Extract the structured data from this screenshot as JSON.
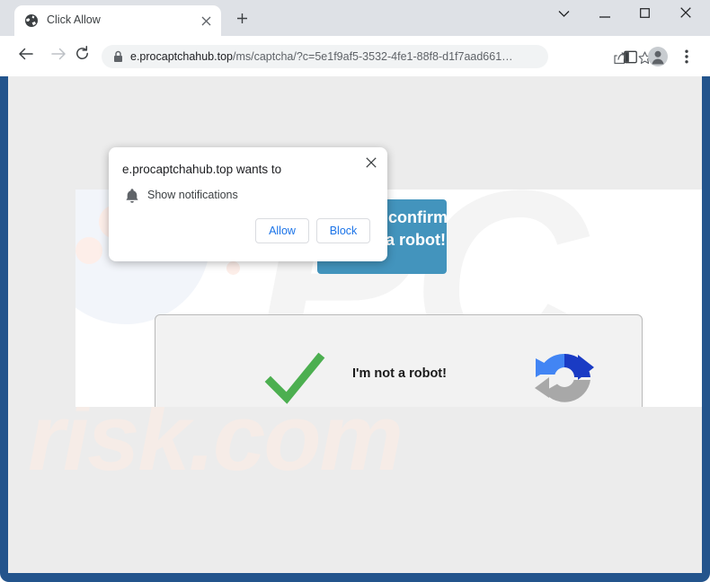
{
  "browser": {
    "tab": {
      "title": "Click Allow",
      "favicon_icon": "globe-icon",
      "close_icon": "close-icon"
    },
    "new_tab_icon": "plus-icon",
    "window_controls": {
      "tab_search_icon": "chevron-down-icon",
      "minimize_icon": "minimize-icon",
      "maximize_icon": "maximize-icon",
      "close_icon": "close-icon"
    },
    "toolbar": {
      "back_icon": "arrow-left-icon",
      "forward_icon": "arrow-right-icon",
      "reload_icon": "reload-icon",
      "lock_icon": "lock-icon",
      "url_host": "e.procaptchahub.top",
      "url_path": "/ms/captcha/?c=5e1f9af5-3532-4fe1-88f8-d1f7aad661…",
      "share_icon": "share-icon",
      "bookmark_icon": "star-icon",
      "side_panel_icon": "side-panel-icon",
      "profile_icon": "person-avatar-icon",
      "menu_icon": "three-dot-menu-icon"
    }
  },
  "permission_dialog": {
    "title": "e.procaptchahub.top wants to",
    "permission_icon": "bell-icon",
    "permission_label": "Show notifications",
    "allow_label": "Allow",
    "block_label": "Block",
    "close_icon": "close-icon"
  },
  "page": {
    "promo_banner": {
      "text": "Click «Allow» to confirm that you are not a robot!",
      "background_color": "#4394bd"
    },
    "captcha": {
      "check_icon": "green-checkmark-icon",
      "label": "I'm not a robot!",
      "refresh_icon": "refresh-arrows-icon",
      "check_color": "#4CAF50"
    },
    "watermark_bottom": "risk.com",
    "watermark_overlay": "PC"
  }
}
